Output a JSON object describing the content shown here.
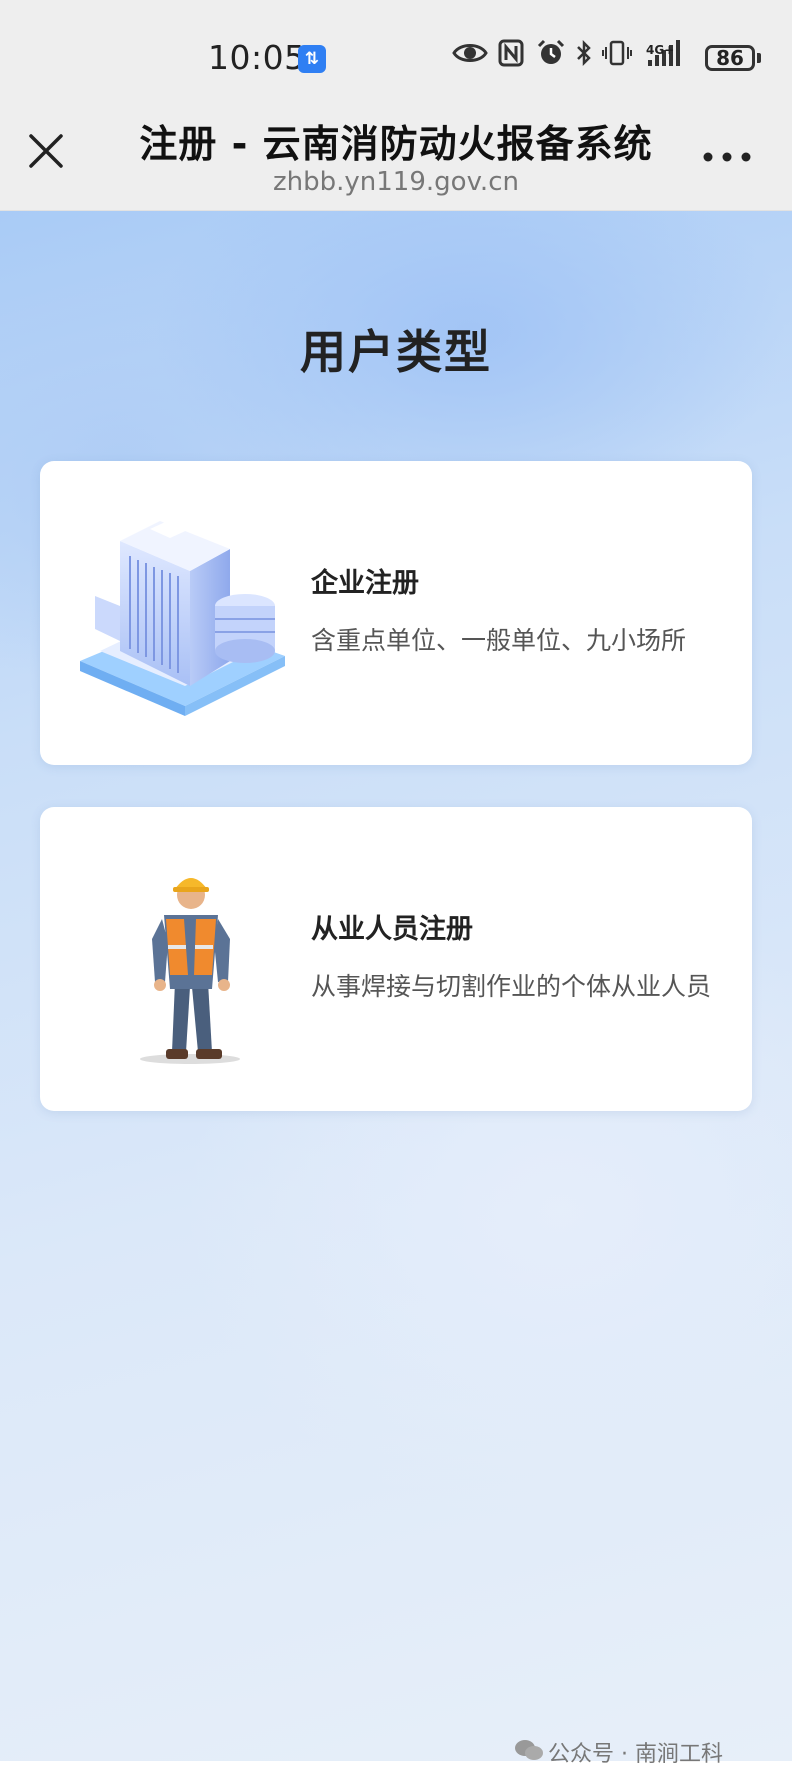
{
  "status_bar": {
    "time": "10:05",
    "data_badge": "⇅",
    "network": "4G+",
    "battery": "86"
  },
  "browser": {
    "title": "注册 - 云南消防动火报备系统",
    "url": "zhbb.yn119.gov.cn"
  },
  "page": {
    "heading": "用户类型",
    "cards": [
      {
        "title": "企业注册",
        "description": "含重点单位、一般单位、九小场所",
        "icon": "office-building-icon"
      },
      {
        "title": "从业人员注册",
        "description": "从事焊接与切割作业的个体从业人员",
        "icon": "worker-icon"
      }
    ]
  },
  "footer": {
    "text": "公众号 · 南涧工科"
  }
}
